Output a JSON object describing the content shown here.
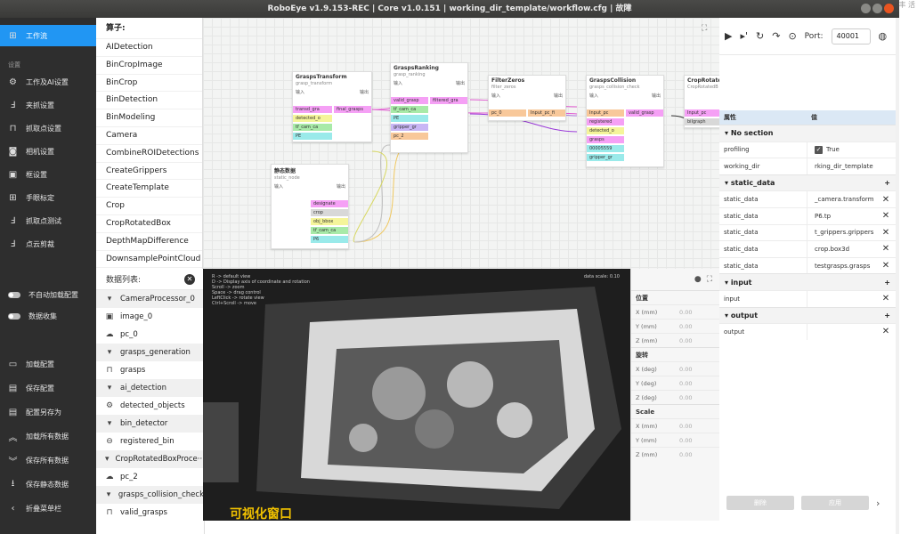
{
  "window": {
    "title": "RoboEye v1.9.153-REC | Core v1.0.151 | working_dir_template/workflow.cfg | 故障"
  },
  "edge_fragment": "丰 活",
  "sidebar": {
    "active": {
      "label": "工作流"
    },
    "section_label": "设置",
    "items": [
      {
        "label": "工作及AI设置",
        "icon": "gear-icon"
      },
      {
        "label": "夹抓设置",
        "icon": "gripper-icon"
      },
      {
        "label": "抓取点设置",
        "icon": "grasp-icon"
      },
      {
        "label": "相机设置",
        "icon": "camera-icon"
      },
      {
        "label": "框设置",
        "icon": "box-icon"
      },
      {
        "label": "手眼标定",
        "icon": "calibration-icon"
      },
      {
        "label": "抓取点测试",
        "icon": "test-icon"
      },
      {
        "label": "点云剪裁",
        "icon": "crop-icon"
      }
    ],
    "toggles": [
      {
        "label": "不自动加载配置"
      },
      {
        "label": "数据收集"
      }
    ],
    "actions": [
      {
        "label": "加载配置"
      },
      {
        "label": "保存配置"
      },
      {
        "label": "配置另存为"
      },
      {
        "label": "加载所有数据"
      },
      {
        "label": "保存所有数据"
      },
      {
        "label": "保存静态数据"
      }
    ],
    "collapse": {
      "label": "折叠菜单栏"
    }
  },
  "operators": {
    "title": "算子:",
    "items": [
      "AIDetection",
      "BinCropImage",
      "BinCrop",
      "BinDetection",
      "BinModeling",
      "Camera",
      "CombineROIDetections",
      "CreateGrippers",
      "CreateTemplate",
      "Crop",
      "CropRotatedBox",
      "DepthMapDifference",
      "DownsamplePointCloud"
    ]
  },
  "datalist": {
    "title": "数据列表:",
    "rows": [
      {
        "type": "group",
        "label": "CameraProcessor_0"
      },
      {
        "type": "item",
        "label": "image_0",
        "icon": "image-icon"
      },
      {
        "type": "item",
        "label": "pc_0",
        "icon": "cloud-icon"
      },
      {
        "type": "group",
        "label": "grasps_generation"
      },
      {
        "type": "item",
        "label": "grasps",
        "icon": "gripper-icon"
      },
      {
        "type": "group",
        "label": "ai_detection"
      },
      {
        "type": "item",
        "label": "detected_objects",
        "icon": "gear-icon"
      },
      {
        "type": "group",
        "label": "bin_detector"
      },
      {
        "type": "item",
        "label": "registered_bin",
        "icon": "bin-icon"
      },
      {
        "type": "group",
        "label": "CropRotatedBoxProce···"
      },
      {
        "type": "item",
        "label": "pc_2",
        "icon": "cloud-icon"
      },
      {
        "type": "group",
        "label": "grasps_collision_check"
      },
      {
        "type": "item",
        "label": "valid_grasps",
        "icon": "gripper-icon"
      }
    ]
  },
  "nodes": {
    "transform": {
      "title": "GraspsTransform",
      "sub": "grasp_transform",
      "in": "输入",
      "out": "输出",
      "ports": [
        "transd_gra",
        "detected_o",
        "tf_cam_ca",
        "PE"
      ],
      "out_ports": [
        "final_grasps"
      ]
    },
    "ranking": {
      "title": "GraspsRanking",
      "sub": "grasp_ranking",
      "in": "输入",
      "out": "输出",
      "ports": [
        "valid_grasp",
        "tf_cam_ca",
        "PE",
        "gripper_gr",
        "pc_2"
      ],
      "out_ports": [
        "filtered_gra"
      ]
    },
    "filter": {
      "title": "FilterZeros",
      "sub": "filter_zeros",
      "in": "输入",
      "out": "输出",
      "ports": [
        "pc_0"
      ],
      "out_ports": [
        "Input_pc_fi"
      ]
    },
    "collision": {
      "title": "GraspsCollision",
      "sub": "grasps_collision_check",
      "in": "输入",
      "out": "输出",
      "ports": [
        "Input_pc",
        "registered",
        "detected_o",
        "grasps",
        "00005559",
        "gripper_gr"
      ],
      "out_ports": [
        "valid_grasp"
      ]
    },
    "rotated": {
      "title": "CropRotatedB",
      "sub": "CropRotatedB",
      "in": "",
      "out": "",
      "ports": [
        "Input_pc",
        "bilgraph"
      ],
      "out_ports": []
    },
    "static": {
      "title": "静态数据",
      "sub": "static_node",
      "in": "输入",
      "out": "输出",
      "ports": [
        "designate",
        "crop",
        "obj_bbox",
        "tf_cam_ca",
        "P6"
      ],
      "out_ports": []
    }
  },
  "viewer": {
    "info_lines": [
      "R -> default view",
      "D -> Display axis of coordinate and rotation",
      "Scroll -> zoom",
      "Space -> drag control",
      "LeftClick -> rotate view",
      "Ctrl+Scroll -> move"
    ],
    "scale": "data scale: 0.10",
    "label": "可视化窗口"
  },
  "transform_panel": {
    "sections": [
      {
        "title": "位置",
        "rows": [
          {
            "k": "X (mm)",
            "v": "0.00"
          },
          {
            "k": "Y (mm)",
            "v": "0.00"
          },
          {
            "k": "Z (mm)",
            "v": "0.00"
          }
        ]
      },
      {
        "title": "旋转",
        "rows": [
          {
            "k": "X (deg)",
            "v": "0.00"
          },
          {
            "k": "Y (deg)",
            "v": "0.00"
          },
          {
            "k": "Z (deg)",
            "v": "0.00"
          }
        ]
      },
      {
        "title": "Scale",
        "rows": [
          {
            "k": "X (mm)",
            "v": "0.00"
          },
          {
            "k": "Y (mm)",
            "v": "0.00"
          },
          {
            "k": "Z (mm)",
            "v": "0.00"
          }
        ]
      }
    ]
  },
  "toolbar": {
    "port_label": "Port:",
    "port_value": "40001"
  },
  "properties": {
    "header": {
      "k": "属性",
      "v": "值"
    },
    "no_section": "No section",
    "profiling": {
      "k": "profiling",
      "v": "True"
    },
    "working_dir": {
      "k": "working_dir",
      "v": "rking_dir_template"
    },
    "static_data": {
      "title": "static_data",
      "rows": [
        {
          "k": "static_data",
          "v": "_camera.transform"
        },
        {
          "k": "static_data",
          "v": "P6.tp"
        },
        {
          "k": "static_data",
          "v": "t_grippers.grippers"
        },
        {
          "k": "static_data",
          "v": "crop.box3d"
        },
        {
          "k": "static_data",
          "v": "testgrasps.grasps"
        }
      ]
    },
    "input": {
      "title": "input",
      "rows": [
        {
          "k": "input",
          "v": ""
        }
      ]
    },
    "output": {
      "title": "output",
      "rows": [
        {
          "k": "output",
          "v": ""
        }
      ]
    }
  },
  "bottom_buttons": {
    "delete": "删除",
    "apply": "应用"
  }
}
